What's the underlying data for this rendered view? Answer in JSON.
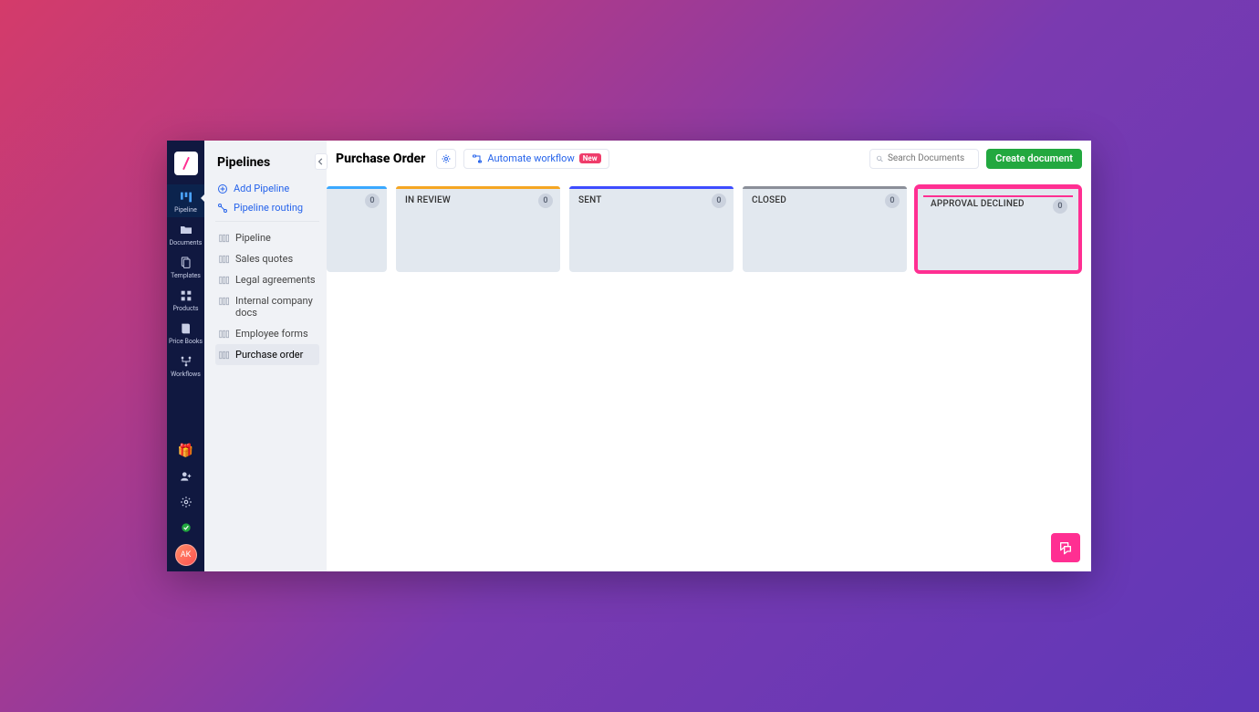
{
  "mainnav": {
    "items": [
      {
        "label": "Pipeline"
      },
      {
        "label": "Documents"
      },
      {
        "label": "Templates"
      },
      {
        "label": "Products"
      },
      {
        "label": "Price Books"
      },
      {
        "label": "Workflows"
      }
    ],
    "avatar_initials": "AK"
  },
  "sidepanel": {
    "title": "Pipelines",
    "add_label": "Add Pipeline",
    "routing_label": "Pipeline routing",
    "pipelines": [
      {
        "label": "Pipeline"
      },
      {
        "label": "Sales quotes"
      },
      {
        "label": "Legal agreements"
      },
      {
        "label": "Internal company docs"
      },
      {
        "label": "Employee forms"
      },
      {
        "label": "Purchase order"
      }
    ],
    "selected_index": 5
  },
  "topbar": {
    "page_title": "Purchase Order",
    "automate_label": "Automate workflow",
    "automate_badge": "New",
    "search_placeholder": "Search Documents",
    "create_label": "Create document"
  },
  "board": {
    "columns": [
      {
        "title": "",
        "count": "0",
        "stripe": "#3aa8ff"
      },
      {
        "title": "IN REVIEW",
        "count": "0",
        "stripe": "#f5a623"
      },
      {
        "title": "SENT",
        "count": "0",
        "stripe": "#3d4cff"
      },
      {
        "title": "CLOSED",
        "count": "0",
        "stripe": "#8b8f99"
      },
      {
        "title": "APPROVAL DECLINED",
        "count": "0",
        "stripe": "#ff2f92",
        "highlight": true
      }
    ]
  }
}
